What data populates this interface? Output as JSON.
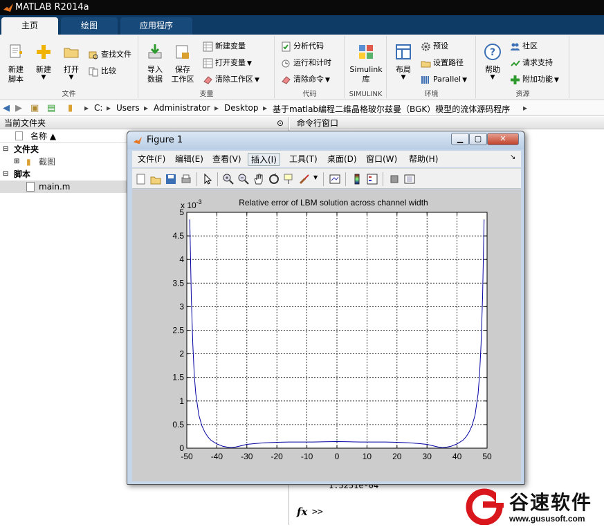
{
  "window": {
    "title": "MATLAB R2014a"
  },
  "tabs": [
    {
      "label": "主页"
    },
    {
      "label": "绘图"
    },
    {
      "label": "应用程序"
    }
  ],
  "ribbon": {
    "file": {
      "new_script": "新建\n脚本",
      "new": "新建",
      "open": "打开",
      "find_files": "查找文件",
      "compare": "比较",
      "label": "文件"
    },
    "variable": {
      "import": "导入\n数据",
      "save_workspace": "保存\n工作区",
      "new_variable": "新建变量",
      "open_variable": "打开变量",
      "clear_workspace": "清除工作区",
      "label": "变量"
    },
    "code": {
      "analyze": "分析代码",
      "run_time": "运行和计时",
      "clear_commands": "清除命令",
      "label": "代码"
    },
    "simulink": {
      "library": "Simulink\n库",
      "label": "SIMULINK"
    },
    "environment": {
      "layout": "布局",
      "preferences": "预设",
      "set_path": "设置路径",
      "parallel": "Parallel",
      "label": "环境"
    },
    "resources": {
      "help": "帮助",
      "community": "社区",
      "request_support": "请求支持",
      "addons": "附加功能",
      "label": "资源"
    }
  },
  "address": {
    "crumbs": [
      "C:",
      "Users",
      "Administrator",
      "Desktop",
      "基于matlab编程二维晶格玻尔兹曼（BGK）模型的流体源码程序"
    ]
  },
  "folder_panel": {
    "title": "当前文件夹",
    "column_name": "名称 ▲",
    "sections": [
      {
        "label": "文件夹",
        "items": [
          {
            "label": "截图"
          }
        ]
      },
      {
        "label": "脚本",
        "items": [
          {
            "label": "main.m"
          }
        ]
      }
    ]
  },
  "command_panel": {
    "title": "命令行窗口",
    "output_line": "1.5251e-04",
    "prompt": ">>",
    "fx": "fx"
  },
  "figure": {
    "title": "Figure 1",
    "menu": [
      "文件(F)",
      "编辑(E)",
      "查看(V)",
      "插入(I)",
      "工具(T)",
      "桌面(D)",
      "窗口(W)",
      "帮助(H)"
    ],
    "selected_menu_index": 3
  },
  "chart_data": {
    "type": "line",
    "title": "Relative error of LBM solution across channel width",
    "xlabel": "",
    "ylabel": "",
    "y_multiplier_label": "x 10",
    "y_multiplier_exponent": "-3",
    "xlim": [
      -50,
      50
    ],
    "ylim": [
      0,
      5
    ],
    "xticks": [
      -50,
      -40,
      -30,
      -20,
      -10,
      0,
      10,
      20,
      30,
      40,
      50
    ],
    "yticks": [
      0,
      0.5,
      1,
      1.5,
      2,
      2.5,
      3,
      3.5,
      4,
      4.5,
      5
    ],
    "grid": true,
    "line_color": "#0000a0",
    "series": [
      {
        "x": [
          -49,
          -48.5,
          -48,
          -47.5,
          -47,
          -46,
          -45,
          -44,
          -43,
          -42,
          -40,
          -38,
          -36,
          -35,
          -34,
          -32,
          -30,
          -27,
          -24,
          -20,
          -16,
          -12,
          -8,
          -4,
          0,
          4,
          8,
          12,
          16,
          20,
          24,
          27,
          30,
          32,
          34,
          35,
          36,
          38,
          40,
          42,
          43,
          44,
          45,
          46,
          47,
          47.5,
          48,
          48.5,
          49
        ],
        "y": [
          4.85,
          3.2,
          2.2,
          1.55,
          1.15,
          0.7,
          0.48,
          0.34,
          0.24,
          0.17,
          0.09,
          0.04,
          0.015,
          0.01,
          0.02,
          0.05,
          0.08,
          0.1,
          0.115,
          0.125,
          0.13,
          0.13,
          0.13,
          0.135,
          0.14,
          0.135,
          0.13,
          0.13,
          0.13,
          0.125,
          0.115,
          0.1,
          0.08,
          0.05,
          0.02,
          0.01,
          0.015,
          0.04,
          0.09,
          0.17,
          0.24,
          0.34,
          0.48,
          0.7,
          1.15,
          1.55,
          2.2,
          3.2,
          4.85
        ]
      }
    ]
  },
  "watermark": {
    "brand": "谷速软件",
    "url": "www.gususoft.com"
  },
  "colors": {
    "titlebar": "#0a0a0a",
    "tabstrip": "#0e3a66",
    "ribbon": "#f3f3f3",
    "figure_frame": "#c5d6ea",
    "watermark_red": "#d9161b"
  }
}
